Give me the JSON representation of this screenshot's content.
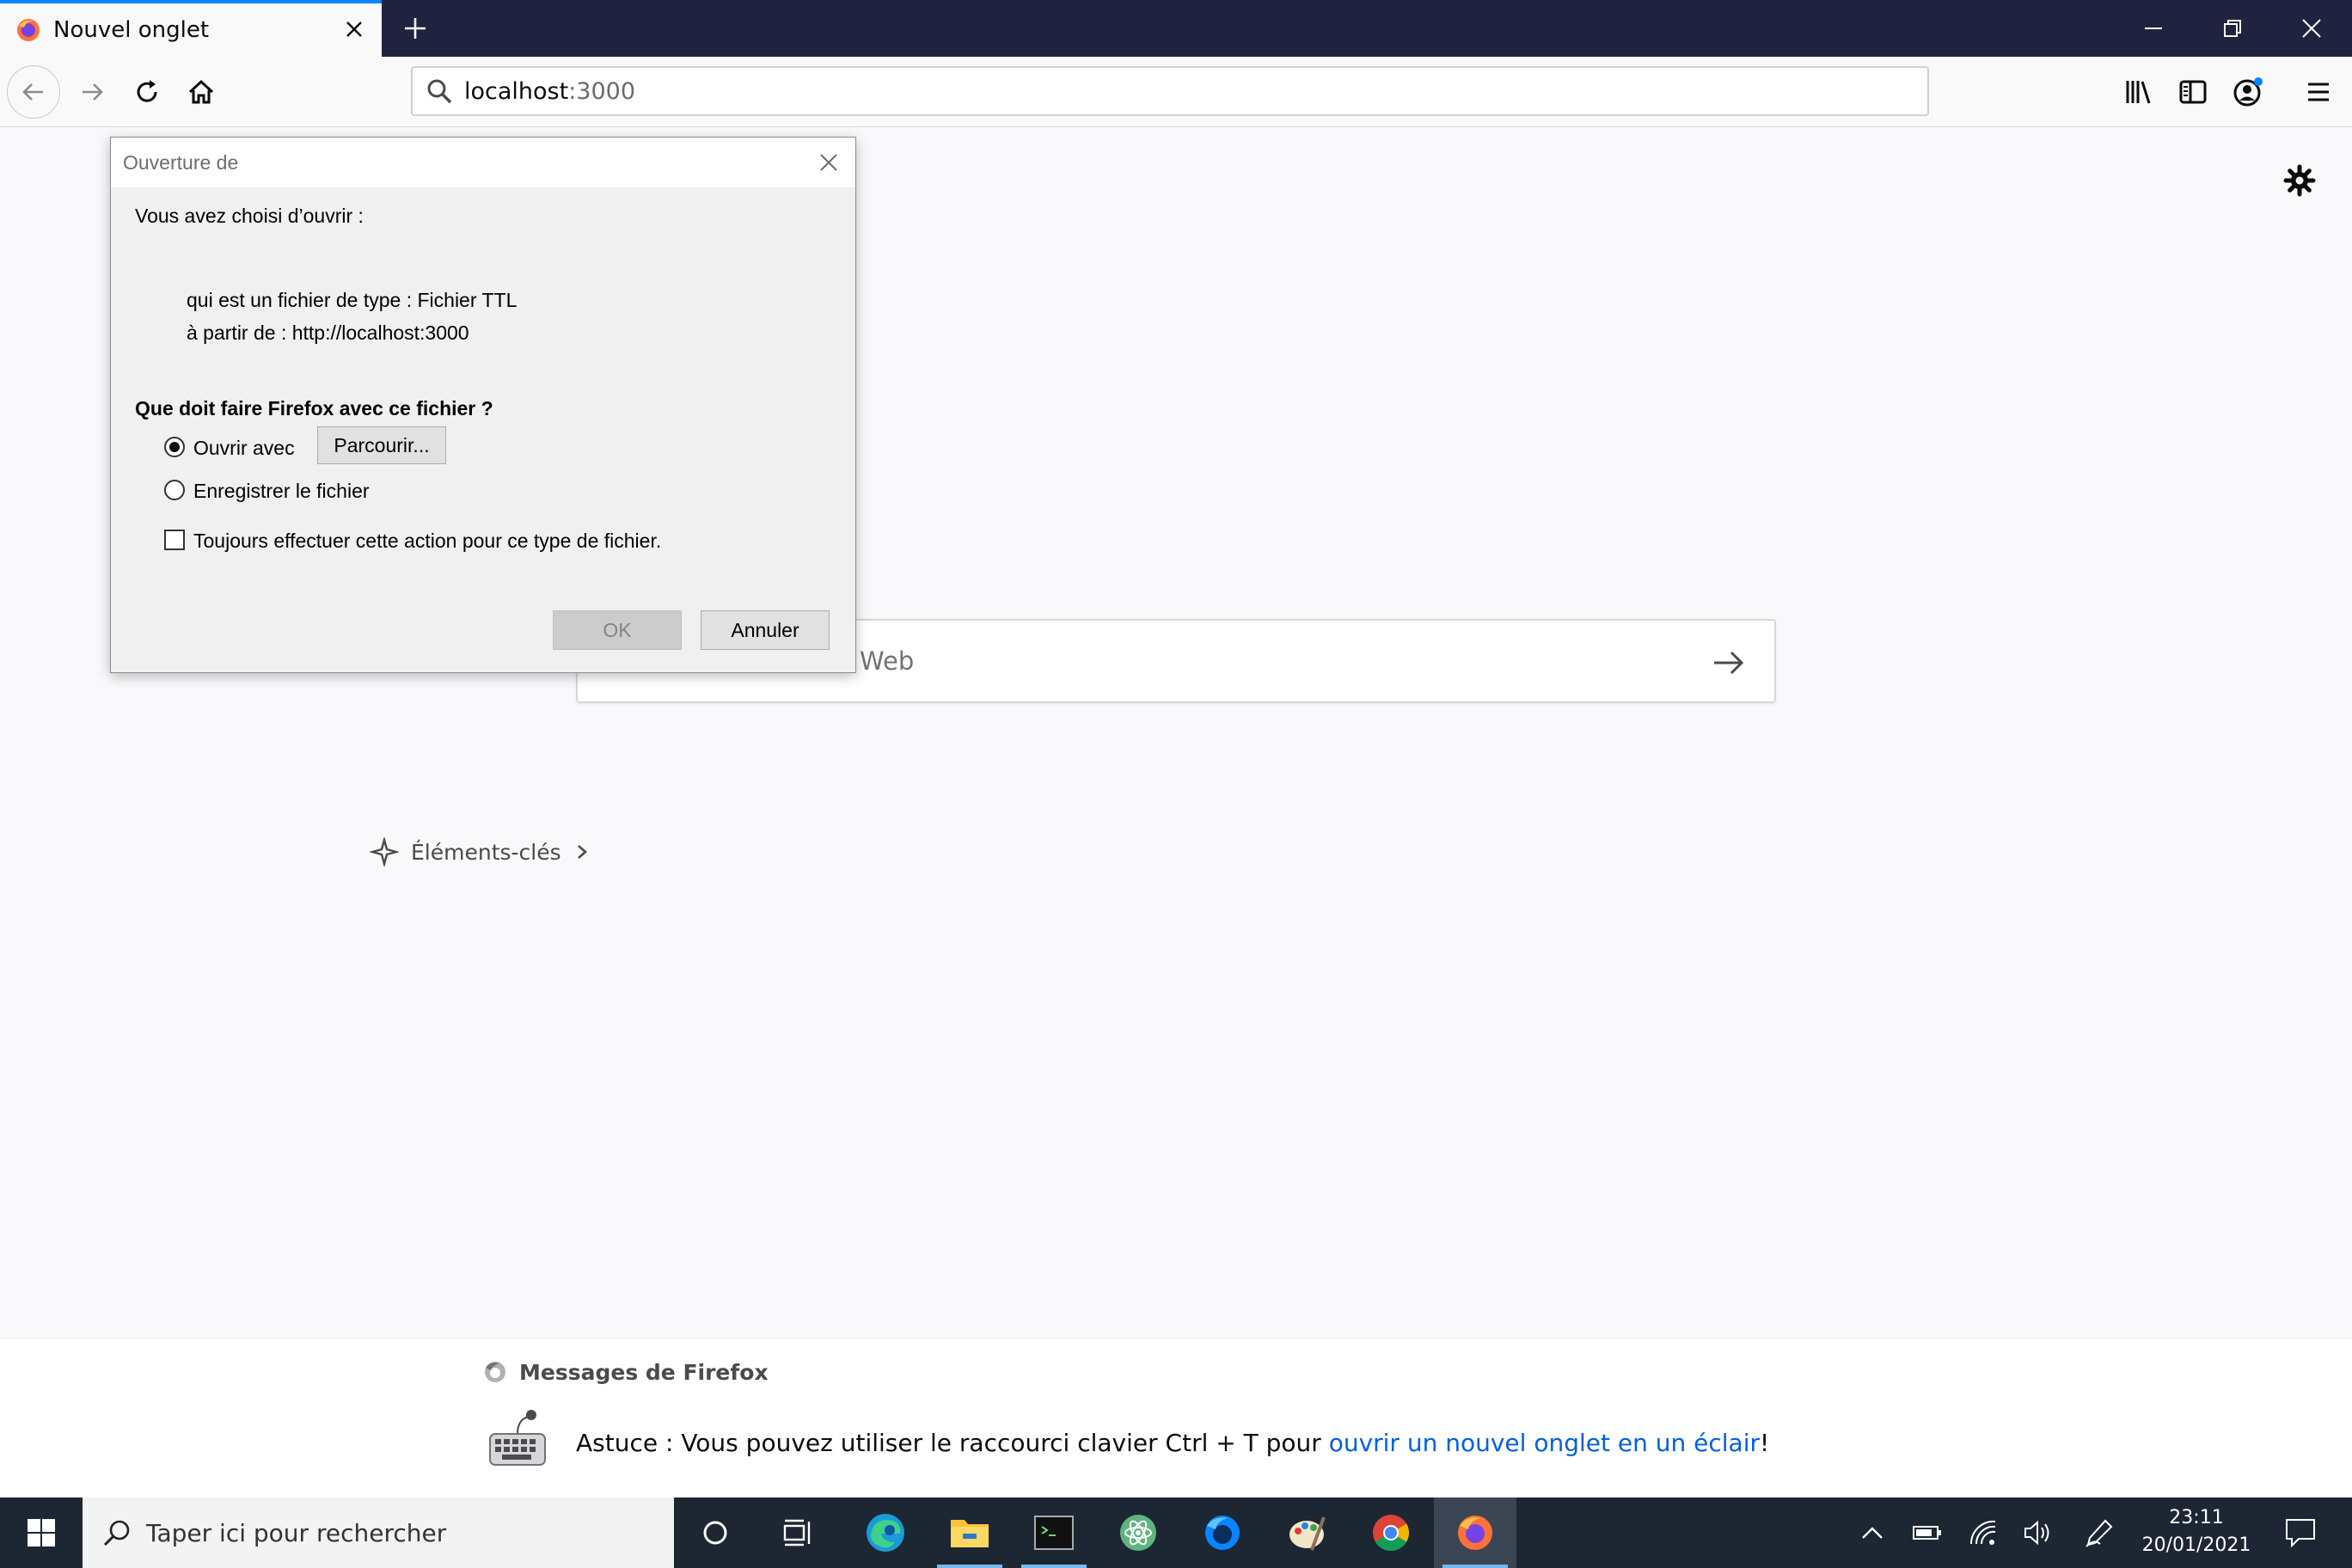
{
  "browser": {
    "tab_title": "Nouvel onglet",
    "url_host": "localhost",
    "url_port": ":3000"
  },
  "newtab": {
    "search_placeholder_tail": "Web",
    "highlights_label": "Éléments-clés",
    "messages_title": "Messages de Firefox",
    "tip_prefix": "Astuce : Vous pouvez utiliser le raccourci clavier Ctrl + T pour ",
    "tip_link": "ouvrir un nouvel onglet en un éclair",
    "tip_suffix": "!"
  },
  "dialog": {
    "title": "Ouverture de",
    "intro": "Vous avez choisi d’ouvrir :",
    "type_line": "qui est un fichier de type :  Fichier TTL",
    "from_line": "à partir de :  http://localhost:3000",
    "question": "Que doit faire Firefox avec ce fichier ?",
    "open_with_label": "Ouvrir avec",
    "browse_button": "Parcourir...",
    "save_label": "Enregistrer le fichier",
    "always_label": "Toujours effectuer cette action pour ce type de fichier.",
    "ok_button": "OK",
    "cancel_button": "Annuler",
    "open_with_selected": true,
    "always_checked": false
  },
  "taskbar": {
    "search_placeholder": "Taper ici pour rechercher",
    "time": "23:11",
    "date": "20/01/2021"
  },
  "colors": {
    "accent": "#0a84ff",
    "tabstrip": "#202340",
    "taskbar": "#1c2733",
    "link": "#0060df"
  }
}
